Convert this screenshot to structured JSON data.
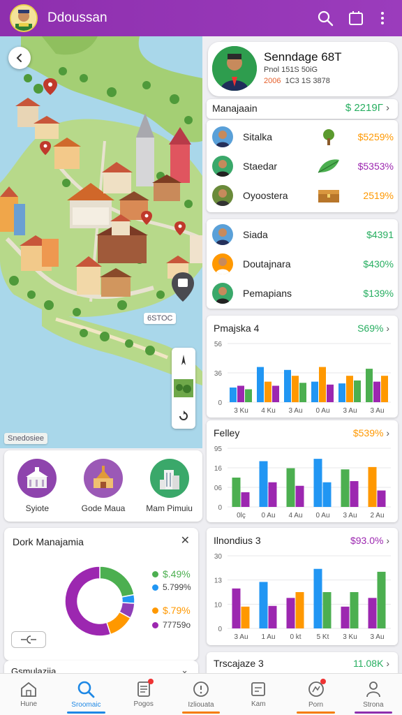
{
  "app": {
    "title": "Ddoussan"
  },
  "map": {
    "label_left": "Snedosiee",
    "label_right": "6STOC"
  },
  "categories": [
    {
      "label": "Syiote",
      "color": "#8e44ad"
    },
    {
      "label": "Gode Maua",
      "color": "#8e44ad"
    },
    {
      "label": "Mam Pimuiu",
      "color": "#27ae60"
    }
  ],
  "donut": {
    "title": "Dork Manajamia",
    "legend": [
      {
        "label": "$.49%",
        "color": "#4caf50"
      },
      {
        "label": "5.799%",
        "color": "#2196f3"
      },
      {
        "label": "$.79%",
        "color": "#ff9800"
      },
      {
        "label": "77759o",
        "color": "#9c27b0"
      }
    ],
    "slices": [
      {
        "value": 22,
        "color": "#4caf50"
      },
      {
        "value": 4,
        "color": "#2196f3"
      },
      {
        "value": 7,
        "color": "#8e3fb8"
      },
      {
        "value": 12,
        "color": "#ff9800"
      },
      {
        "value": 55,
        "color": "#9c27b0"
      }
    ]
  },
  "bottom_left_card": {
    "title": "Gsmulazija"
  },
  "profile": {
    "name": "Senndage 68T",
    "line1": "Pnol 151S 50iG",
    "line2_a": "2006",
    "line2_b": "1C3 1S 3878"
  },
  "summary": {
    "title": "Manajaain",
    "value": "$ 2219Г"
  },
  "list1": [
    {
      "name": "Sitalka",
      "value": "$5259%",
      "color": "#ff9800",
      "icon": "tree-icon"
    },
    {
      "name": "Staedar",
      "value": "$5353%",
      "color": "#9c27b0",
      "icon": "leaf-icon"
    },
    {
      "name": "Oyoostera",
      "value": "2519%",
      "color": "#ff9800",
      "icon": "chest-icon"
    }
  ],
  "list2": [
    {
      "name": "Siada",
      "value": "$4391",
      "color": "#27ae60"
    },
    {
      "name": "Doutajnara",
      "value": "$430%",
      "color": "#27ae60"
    },
    {
      "name": "Pemapians",
      "value": "$139%",
      "color": "#27ae60"
    }
  ],
  "charts": [
    {
      "title": "Pmajska 4",
      "value": "S69%",
      "value_color": "#27ae60",
      "yticks": [
        "56",
        "36",
        "0"
      ],
      "xticks": [
        "3 Ku",
        "4 Ku",
        "3 Au",
        "0 Au",
        "3 Au",
        "3 Au"
      ],
      "bars": [
        {
          "v": 0.25,
          "c": "#2196f3"
        },
        {
          "v": 0.28,
          "c": "#9c27b0"
        },
        {
          "v": 0.22,
          "c": "#4caf50"
        },
        {
          "v": 0.6,
          "c": "#2196f3"
        },
        {
          "v": 0.35,
          "c": "#ff9800"
        },
        {
          "v": 0.28,
          "c": "#9c27b0"
        },
        {
          "v": 0.55,
          "c": "#2196f3"
        },
        {
          "v": 0.45,
          "c": "#ff9800"
        },
        {
          "v": 0.33,
          "c": "#4caf50"
        },
        {
          "v": 0.35,
          "c": "#2196f3"
        },
        {
          "v": 0.6,
          "c": "#ff9800"
        },
        {
          "v": 0.3,
          "c": "#9c27b0"
        },
        {
          "v": 0.32,
          "c": "#2196f3"
        },
        {
          "v": 0.45,
          "c": "#ff9800"
        },
        {
          "v": 0.37,
          "c": "#4caf50"
        },
        {
          "v": 0.57,
          "c": "#4caf50"
        },
        {
          "v": 0.35,
          "c": "#9c27b0"
        },
        {
          "v": 0.45,
          "c": "#ff9800"
        }
      ]
    },
    {
      "title": "Felley",
      "value": "$539%",
      "value_color": "#ff9800",
      "yticks": [
        "95",
        "16",
        "06",
        "0"
      ],
      "xticks": [
        "0lç",
        "0 Au",
        "4 Au",
        "0 Au",
        "3 Au",
        "2 Au"
      ],
      "bars": [
        {
          "v": 0.5,
          "c": "#4caf50"
        },
        {
          "v": 0.25,
          "c": "#9c27b0"
        },
        {
          "v": 0.78,
          "c": "#2196f3"
        },
        {
          "v": 0.42,
          "c": "#9c27b0"
        },
        {
          "v": 0.66,
          "c": "#4caf50"
        },
        {
          "v": 0.36,
          "c": "#9c27b0"
        },
        {
          "v": 0.82,
          "c": "#2196f3"
        },
        {
          "v": 0.42,
          "c": "#2196f3"
        },
        {
          "v": 0.64,
          "c": "#4caf50"
        },
        {
          "v": 0.44,
          "c": "#9c27b0"
        },
        {
          "v": 0.68,
          "c": "#ff9800"
        },
        {
          "v": 0.28,
          "c": "#9c27b0"
        }
      ]
    },
    {
      "title": "Ilnondius 3",
      "value": "$93.0%",
      "value_color": "#9c27b0",
      "yticks": [
        "30",
        "13",
        "10",
        "0"
      ],
      "xticks": [
        "3 Au",
        "1 Au",
        "0 kt",
        "5 Kt",
        "3 Ku",
        "3 Au"
      ],
      "bars": [
        {
          "v": 0.55,
          "c": "#9c27b0"
        },
        {
          "v": 0.3,
          "c": "#ff9800"
        },
        {
          "v": 0.64,
          "c": "#2196f3"
        },
        {
          "v": 0.31,
          "c": "#9c27b0"
        },
        {
          "v": 0.42,
          "c": "#9c27b0"
        },
        {
          "v": 0.5,
          "c": "#ff9800"
        },
        {
          "v": 0.82,
          "c": "#2196f3"
        },
        {
          "v": 0.5,
          "c": "#4caf50"
        },
        {
          "v": 0.3,
          "c": "#9c27b0"
        },
        {
          "v": 0.5,
          "c": "#4caf50"
        },
        {
          "v": 0.42,
          "c": "#9c27b0"
        },
        {
          "v": 0.78,
          "c": "#4caf50"
        }
      ]
    }
  ],
  "bottom_right_card": {
    "title": "Trscajaze 3",
    "value": "11.08K",
    "value_color": "#27ae60"
  },
  "nav": [
    {
      "label": "Hune",
      "icon": "home-icon",
      "active": false,
      "badge": false,
      "underline": ""
    },
    {
      "label": "Sroomaic",
      "icon": "search-icon",
      "active": true,
      "badge": false,
      "underline": "#1e88e5"
    },
    {
      "label": "Pogos",
      "icon": "document-icon",
      "active": false,
      "badge": true,
      "underline": ""
    },
    {
      "label": "Izliouata",
      "icon": "info-icon",
      "active": false,
      "badge": false,
      "underline": "#f57c00"
    },
    {
      "label": "Kam",
      "icon": "list-icon",
      "active": false,
      "badge": false,
      "underline": ""
    },
    {
      "label": "Porn",
      "icon": "feed-icon",
      "active": false,
      "badge": true,
      "underline": "#f57c00"
    },
    {
      "label": "Strona",
      "icon": "profile-icon",
      "active": false,
      "badge": false,
      "underline": "#8e2fae"
    }
  ]
}
